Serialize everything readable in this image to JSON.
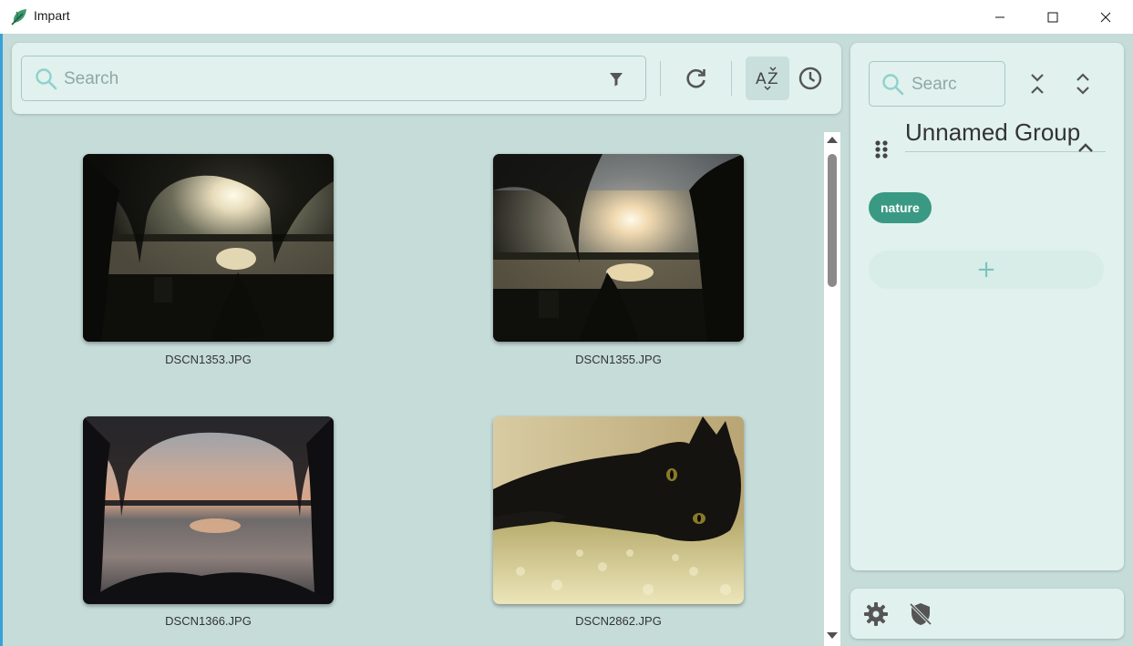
{
  "window": {
    "title": "Impart",
    "controls": [
      "minimize",
      "maximize",
      "close"
    ]
  },
  "toolbar": {
    "search_placeholder": "Search",
    "filter_icon": "filter-icon",
    "refresh_icon": "refresh-icon",
    "sort_icon": "sort-alpha-icon",
    "sort_active": true,
    "history_icon": "history-icon"
  },
  "gallery": {
    "images": [
      {
        "filename": "DSCN1353.JPG",
        "subject": "willow silhouette sunset over lake"
      },
      {
        "filename": "DSCN1355.JPG",
        "subject": "willow silhouette sunset over lake"
      },
      {
        "filename": "DSCN1366.JPG",
        "subject": "willow branches sunset reflection on lake"
      },
      {
        "filename": "DSCN2862.JPG",
        "subject": "black cat lying on carpet"
      }
    ]
  },
  "tag_panel": {
    "search_placeholder": "Searc",
    "collapse_all_icon": "collapse-all-icon",
    "expand_all_icon": "expand-all-icon",
    "group": {
      "name": "Unnamed Group",
      "tags": [
        "nature"
      ],
      "add_symbol": "+"
    }
  },
  "bottom_bar": {
    "settings_icon": "gear-icon",
    "shield_icon": "shield-off-icon"
  },
  "colors": {
    "background": "#c5dcd8",
    "panel": "#e0f1ee",
    "tag_chip": "#3a9983",
    "accent_icon": "#2e8b57"
  }
}
